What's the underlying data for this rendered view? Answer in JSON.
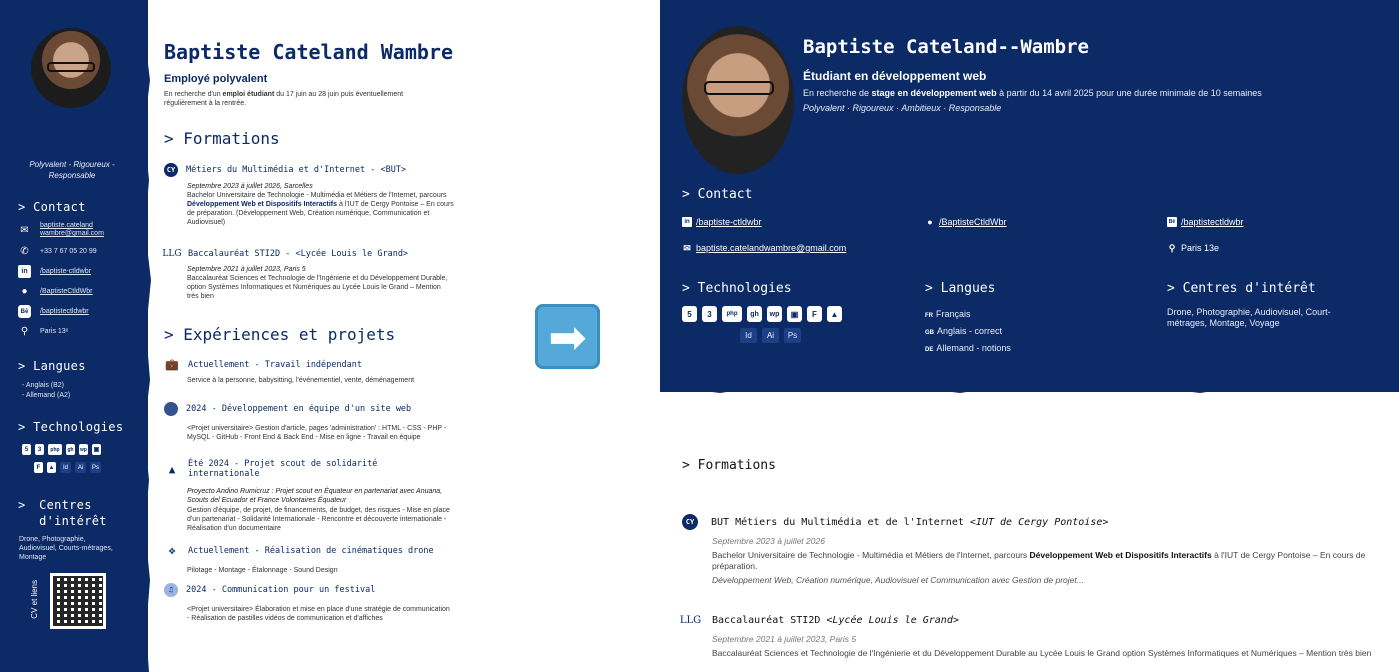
{
  "left": {
    "sidebar": {
      "quote": "Polyvalent - Rigoureux - Responsable",
      "contact_h": "Contact",
      "email": "baptiste.cateland wambre@gmail.com",
      "phone": "+33 7 67 05 20 99",
      "linkedin": "/baptiste-ctldwbr",
      "github": "/BaptisteCtldWbr",
      "behance": "/baptistectldwbr",
      "location": "Paris 13ᵉ",
      "langues_h": "Langues",
      "langues": [
        "-  Anglais (B2)",
        "-  Allemand (A2)"
      ],
      "tech_h": "Technologies",
      "tech_row1": [
        "5",
        "3",
        "php",
        "gh",
        "wp",
        "▣",
        "⬤"
      ],
      "tech_row2": [
        "F",
        "▲",
        "Id",
        "Ai",
        "Ps"
      ],
      "interests_h1": "Centres",
      "interests_h2": "d'intérêt",
      "interests": "Drone, Photographie, Audiovisuel, Courts-métrages, Montage",
      "qr_label": "CV et liens"
    },
    "name": "Baptiste Cateland Wambre",
    "role": "Employé polyvalent",
    "desc_pre": "En recherche d'un ",
    "desc_bold": "emploi étudiant",
    "desc_post": " du 17 juin au 28 juin puis éventuellement régulièrement à la rentrée.",
    "formations_h": "Formations",
    "f1_title": "Métiers du Multimédia et d'Internet - <BUT>",
    "f1_date": "Septembre 2023 à juillet 2026, Sarcelles",
    "f1_pre": "Bachelor Universitaire de Technologie - Multimédia et Métiers de l'Internet, parcours ",
    "f1_bold": "Développement Web et Dispositifs Interactifs",
    "f1_post": " à l'IUT de Cergy Pontoise – En cours de préparation. (Développement Web, Création numérique, Communication et Audiovisuel)",
    "f2_title": "Baccalauréat STI2D - <Lycée Louis le Grand>",
    "f2_date": "Septembre 2021 à juillet 2023, Paris 5",
    "f2_txt": "Baccalauréat Sciences et Technologie de l'Ingénierie et du Développement Durable, option Systèmes Informatiques et Numériques au Lycée Louis le Grand – Mention très bien",
    "exp_h": "Expériences et projets",
    "e1_title": "Actuellement - Travail indépendant",
    "e1_txt": "Service à la personne, babysitting, l'événementiel, vente, déménagement",
    "e2_title": "2024 - Développement en équipe d'un site web",
    "e2_txt": "<Projet universitaire> Gestion d'article, pages 'administration' : HTML - CSS - PHP - MySQL - GitHub - Front End & Back End - Mise en ligne - Travail en équipe",
    "e3_title": "Été 2024 - Projet scout de solidarité internationale",
    "e3_sub": "Proyecto Andino Rumicruz : Projet scout en Équateur en partenariat avec Anuana, Scouts del Ecuador et France Volontaires Équateur",
    "e3_txt": "Gestion d'équipe, de projet, de financements, de budget, des risques - Mise en place d'un partenariat - Solidarité Internationale - Rencontre et découverte internationale - Réalisation d'un documentaire",
    "e4_title": "Actuellement - Réalisation de cinématiques drone",
    "e4_txt": "Pilotage - Montage - Étalonnage - Sound Design",
    "e5_title": "2024 - Communication pour un festival",
    "e5_txt": "<Projet universitaire> Élaboration et mise en place d'une stratégie de communication - Réalisation de pastilles vidéos de communication et d'affiches"
  },
  "arrow": "➡",
  "right": {
    "name": "Baptiste Cateland--Wambre",
    "role": "Étudiant en développement web",
    "desc_pre": "En recherche de ",
    "desc_bold": "stage en développement web",
    "desc_post": " à partir du 14 avril 2025 pour une durée minimale de 10 semaines",
    "quals": "Polyvalent · Rigoureux · Ambitieux · Responsable",
    "contact_h": "> Contact",
    "linkedin": "/baptiste-ctldwbr",
    "github": "/BaptisteCtldWbr",
    "behance": "/baptistectldwbr",
    "email": "baptiste.catelandwambre@gmail.com",
    "location": "Paris 13e",
    "tech_h": "> Technologies",
    "tech_row1": [
      "5",
      "3",
      "php",
      "gh",
      "wp",
      "▣",
      "F",
      "▲"
    ],
    "tech_row2": [
      "Id",
      "Ai",
      "Ps"
    ],
    "langues_h": "> Langues",
    "langues": [
      {
        "code": "FR",
        "label": "Français"
      },
      {
        "code": "GB",
        "label": "Anglais - correct"
      },
      {
        "code": "DE",
        "label": "Allemand - notions"
      }
    ],
    "interests_h": "> Centres d'intérêt",
    "interests": "Drone, Photographie, Audiovisuel, Court-métrages, Montage, Voyage",
    "formations_h": "> Formations",
    "f1_title": "BUT Métiers du Multimédia et de l'Internet",
    "f1_school": "<IUT de Cergy Pontoise>",
    "f1_date": "Septembre 2023 à juillet 2026",
    "f1_pre": "Bachelor Universitaire de Technologie - Multimédia et Métiers de l'Internet, parcours ",
    "f1_bold": "Développement Web et Dispositifs Interactifs",
    "f1_post": " à l'IUT de Cergy Pontoise – En cours de préparation.",
    "f1_note": "Développement Web, Création numérique, Audiovisuel et Communication avec Gestion de projet...",
    "f2_title": "Baccalauréat STI2D",
    "f2_school": "<Lycée Louis le Grand>",
    "f2_date": "Septembre 2021 à juillet 2023, Paris 5",
    "f2_txt": "Baccalauréat Sciences et Technologie de l'Ingénierie et du Développement Durable au Lycée Louis le Grand option Systèmes Informatiques et Numériques – Mention très bien"
  },
  "colors": {
    "navy": "#0b2a66",
    "arrow": "#54a9d8"
  }
}
